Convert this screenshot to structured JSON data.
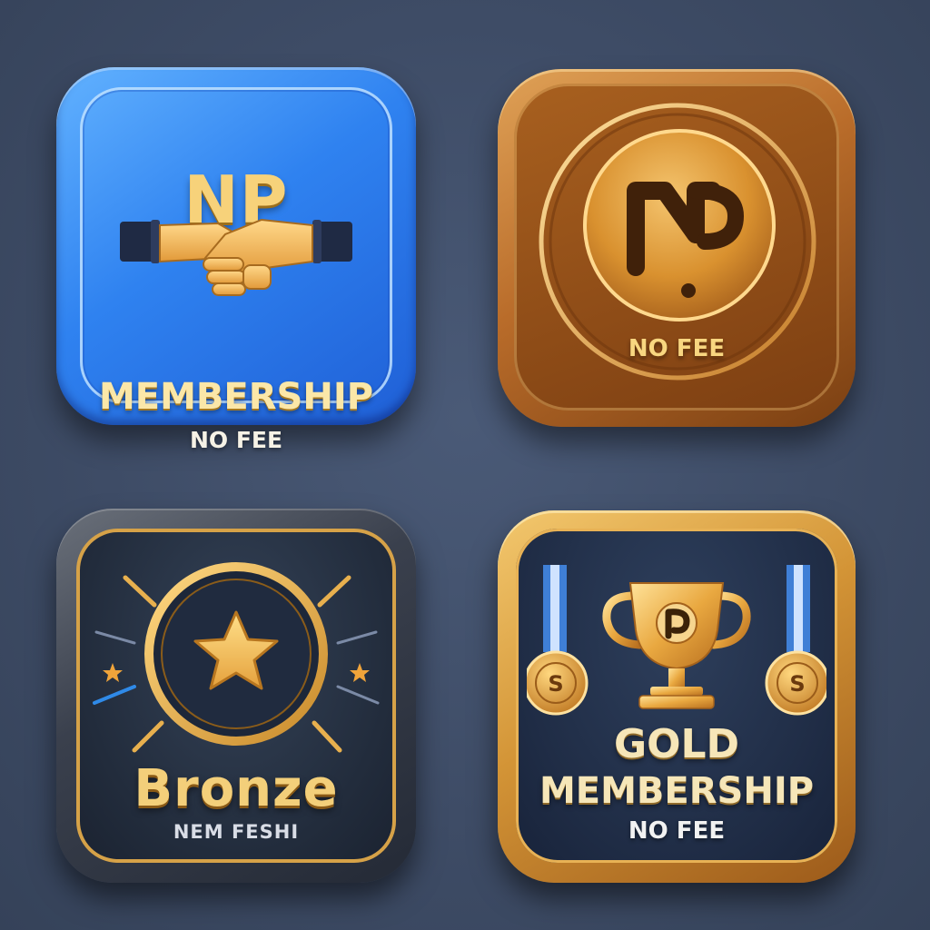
{
  "badges": {
    "blue": {
      "logo_text": "NP",
      "title": "Membership",
      "subtitle": "NO FEE",
      "icon": "handshake-icon",
      "colors": {
        "base": "#2f82f0",
        "accent": "#f7d27a"
      }
    },
    "coin": {
      "subtitle": "NO FEE",
      "icon": "np-coin-icon",
      "colors": {
        "base": "#b96c2a",
        "accent": "#f8d680"
      }
    },
    "star": {
      "title": "Bronze",
      "subtitle": "NEM FESHI",
      "icon": "star-medallion-icon",
      "colors": {
        "base": "#222c3c",
        "accent": "#d6a248"
      }
    },
    "gold": {
      "title_line1": "Gold",
      "title_line2": "Membership",
      "subtitle": "NO FEE",
      "icon": "trophy-icon",
      "colors": {
        "base": "#1f2c45",
        "accent": "#e8b255"
      }
    }
  },
  "background_color": "#3e4c66"
}
